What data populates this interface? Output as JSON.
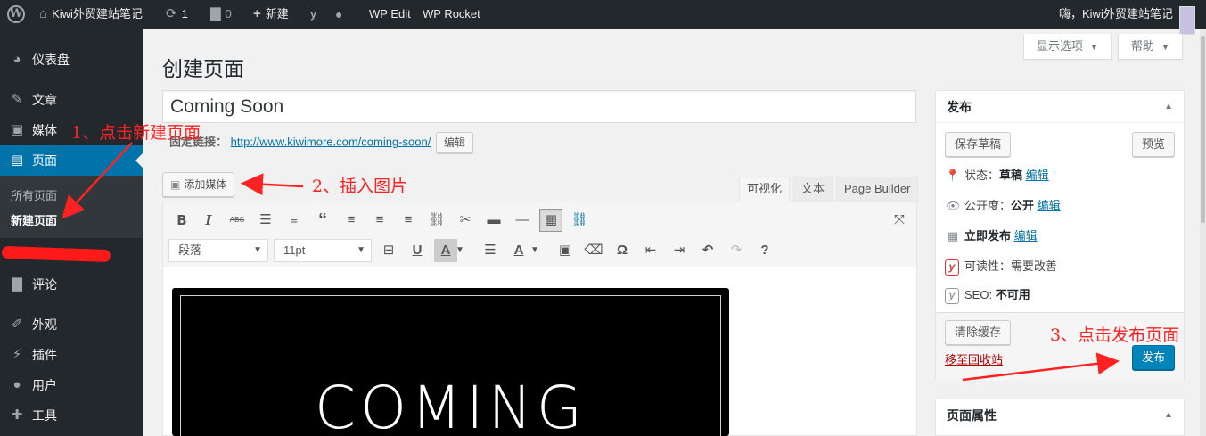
{
  "adminbar": {
    "site_name": "Kiwi外贸建站笔记",
    "updates_count": "1",
    "comments_count": "0",
    "new_label": "新建",
    "wp_edit": "WP Edit",
    "wp_rocket": "WP Rocket",
    "greeting": "嗨，Kiwi外贸建站笔记"
  },
  "sidebar": {
    "items": [
      {
        "label": "仪表盘",
        "icon": "dashboard-icon"
      },
      {
        "label": "文章",
        "icon": "pushpin-icon"
      },
      {
        "label": "媒体",
        "icon": "media-icon"
      },
      {
        "label": "页面",
        "icon": "page-icon"
      },
      {
        "label": "评论",
        "icon": "comment-icon"
      },
      {
        "label": "外观",
        "icon": "brush-icon"
      },
      {
        "label": "插件",
        "icon": "plugin-icon"
      },
      {
        "label": "用户",
        "icon": "user-icon"
      },
      {
        "label": "工具",
        "icon": "wrench-icon"
      }
    ],
    "submenu": [
      "所有页面",
      "新建页面"
    ]
  },
  "header": {
    "screen_options": "显示选项",
    "help": "帮助",
    "page_title": "创建页面"
  },
  "editor": {
    "title_value": "Coming Soon",
    "permalink_label": "固定链接：",
    "permalink_url": "http://www.kiwimore.com/coming-soon/",
    "edit_button": "编辑",
    "add_media": "添加媒体",
    "tabs": [
      "可视化",
      "文本",
      "Page Builder"
    ],
    "format_select": "段落",
    "font_size_select": "11pt",
    "image_text": "COMING"
  },
  "publish": {
    "title": "发布",
    "save_draft": "保存草稿",
    "preview": "预览",
    "status_label": "状态：",
    "status_value": "草稿",
    "status_edit": "编辑",
    "visibility_label": "公开度：",
    "visibility_value": "公开",
    "visibility_edit": "编辑",
    "schedule_value": "立即发布",
    "schedule_edit": "编辑",
    "readability": "可读性：需要改善",
    "seo_label": "SEO:",
    "seo_value": "不可用",
    "clear_cache": "清除缓存",
    "trash": "移至回收站",
    "publish_button": "发布"
  },
  "page_attributes": {
    "title": "页面属性"
  },
  "annotations": {
    "step1": "1、点击新建页面",
    "step2": "2、插入图片",
    "step3": "3、点击发布页面"
  },
  "colors": {
    "admin_dark": "#23282d",
    "accent": "#0073aa",
    "annotation_red": "#ff2222"
  }
}
